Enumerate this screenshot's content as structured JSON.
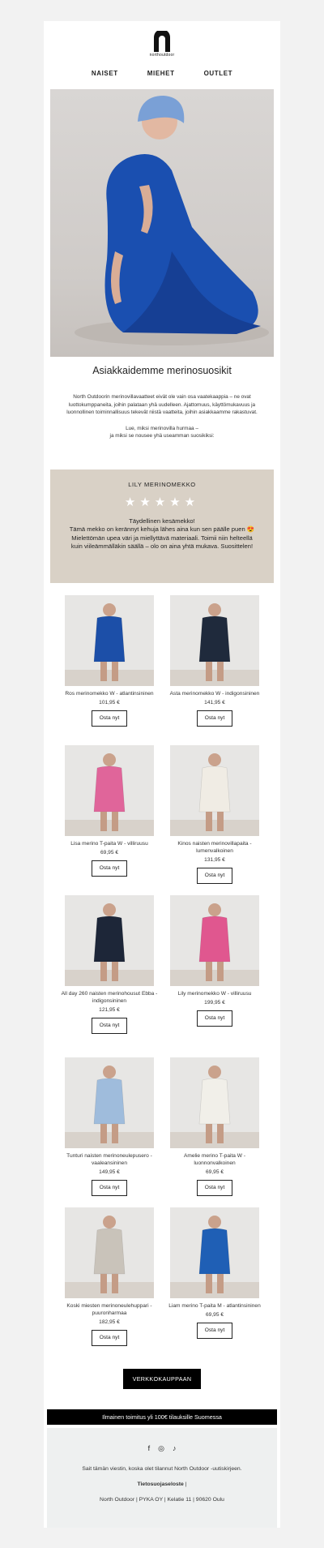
{
  "brand": {
    "logo_text": "northoutdoor"
  },
  "nav": [
    "NAISET",
    "MIEHET",
    "OUTLET"
  ],
  "heading": "Asiakkaidemme merinosuosikit",
  "intro": {
    "p1": "North Outdoorin merinovillavaatteet eivät ole vain osa vaatekaappia – ne ovat luottokumppaneita, joihin palataan yhä uudelleen. Ajattomuus, käyttömukavuus ja luonnollinen toiminnallisuus tekevät niistä vaatteita, joihin asiakkaamme rakastuvat.",
    "p2a": "Lue, miksi merinovilla hurmaa –",
    "p2b": "ja miksi se nousee yhä useamman suosikiksi:"
  },
  "review": {
    "title": "LILY MERINOMEKKO",
    "stars": "★★★★★",
    "line1": "Täydellinen kesämekko!",
    "body": "Tämä mekko on kerännyt kehuja lähes aina kun sen päälle puen 😍 Mielettömän upea väri ja miellyttävä materiaali. Toimii niin helteellä kuin viileämmälläkin säällä – olo on aina yhtä mukava. Suosittelen!"
  },
  "products": [
    {
      "name": "Ros merinomekko W - atlantinsininen",
      "price": "101,95 €",
      "button": "Osta nyt",
      "color": "#1c4fa8"
    },
    {
      "name": "Asta merinomekko W - indigonsininen",
      "price": "141,95 €",
      "button": "Osta nyt",
      "color": "#1f2a3c"
    },
    {
      "name": "Lisa merino T-paita W - villiruusu",
      "price": "69,95 €",
      "button": "Osta nyt",
      "color": "#e0659a"
    },
    {
      "name": "Kinos naisten merinovillapaita - lumenvalkoinen",
      "price": "131,95 €",
      "button": "Osta nyt",
      "color": "#f0ece4"
    },
    {
      "name": "All day 260 naisten merinohousut Ebba - indigonsininen",
      "price": "121,95 €",
      "button": "Osta nyt",
      "color": "#1d2638"
    },
    {
      "name": "Lily merinomekko W - villiruusu",
      "price": "199,95 €",
      "button": "Osta nyt",
      "color": "#e0578f"
    },
    {
      "name": "Tunturi naisten merinoneulepusero - vaaleansininen",
      "price": "149,95 €",
      "button": "Osta nyt",
      "color": "#9fbcdc"
    },
    {
      "name": "Amelie merino T-paita W - luonnonvalkoinen",
      "price": "69,95 €",
      "button": "Osta nyt",
      "color": "#f1efe9"
    },
    {
      "name": "Koski miesten merinoneulehuppari - puuronharmaa",
      "price": "182,95 €",
      "button": "Osta nyt",
      "color": "#c9c3ba"
    },
    {
      "name": "Liam merino T-paita M - atlantinsininen",
      "price": "69,95 €",
      "button": "Osta nyt",
      "color": "#1f5fb5"
    }
  ],
  "shop_button": "VERKKOKAUPPAAN",
  "shipping": "Ilmainen toimitus yli 100€ tilauksille Suomessa",
  "footer": {
    "social": [
      "f",
      "◎",
      "♪"
    ],
    "note": "Sait tämän viestin, koska olet tilannut North Outdoor -uutiskirjeen.",
    "privacy": "Tietosuojaseloste",
    "privacy_sep": " |",
    "address": "North Outdoor | PYKA OY | Kelatie 11 | 90620 Oulu"
  }
}
